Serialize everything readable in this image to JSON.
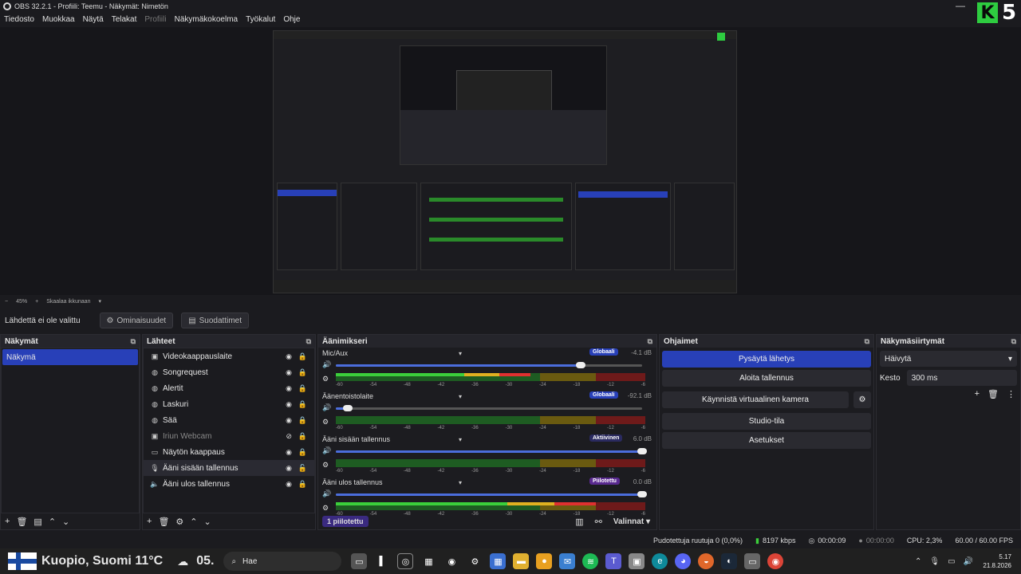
{
  "window": {
    "title": "OBS 32.2.1 - Profiili: Teemu - Näkymät: Nimetön"
  },
  "menu": [
    "Tiedosto",
    "Muokkaa",
    "Näytä",
    "Telakat",
    "Profiili",
    "Näkymäkokoelma",
    "Työkalut",
    "Ohje"
  ],
  "brand": {
    "k": "K",
    "num": "5"
  },
  "zoom": {
    "level": "45%",
    "mode": "Skaalaa ikkunaan"
  },
  "context": {
    "no_source": "Lähdettä ei ole valittu",
    "properties": "Ominaisuudet",
    "filters": "Suodattimet"
  },
  "scenes": {
    "title": "Näkymät",
    "items": [
      "Näkymä"
    ]
  },
  "sources": {
    "title": "Lähteet",
    "items": [
      {
        "label": "Videokaappauslaite",
        "icon": "camera-icon"
      },
      {
        "label": "Songrequest",
        "icon": "globe-icon"
      },
      {
        "label": "Alertit",
        "icon": "globe-icon"
      },
      {
        "label": "Laskuri",
        "icon": "globe-icon"
      },
      {
        "label": "Sää",
        "icon": "globe-icon"
      },
      {
        "label": "Iriun Webcam",
        "icon": "camera-icon"
      },
      {
        "label": "Näytön kaappaus",
        "icon": "monitor-icon"
      },
      {
        "label": "Ääni sisään tallennus",
        "icon": "mic-icon"
      },
      {
        "label": "Ääni ulos tallennus",
        "icon": "speaker-icon"
      }
    ]
  },
  "mixer": {
    "title": "Äänimikseri",
    "channels": [
      {
        "name": "Mic/Aux",
        "badge": "Globaali",
        "db": "-4.1 dB",
        "color": "#2840b8",
        "vol": 0.8,
        "lvl": 0.63
      },
      {
        "name": "Äänentoistolaite",
        "badge": "Globaali",
        "db": "-92.1 dB",
        "color": "#2840b8",
        "vol": 0.04,
        "lvl": 0.0
      },
      {
        "name": "Ääni sisään tallennus",
        "badge": "Aktiivinen",
        "db": "6.0 dB",
        "color": "#2a2a60",
        "vol": 1.0,
        "lvl": 0.0
      },
      {
        "name": "Ääni ulos tallennus",
        "badge": "Piilotettu",
        "db": "0.0 dB",
        "color": "#5a2a90",
        "vol": 1.0,
        "lvl": 0.84
      }
    ],
    "ticks": [
      "-60",
      "-54",
      "-48",
      "-42",
      "-36",
      "-30",
      "-24",
      "-18",
      "-12",
      "-6"
    ],
    "hidden_btn": "1 piilotettu",
    "options": "Valinnat"
  },
  "controls": {
    "title": "Ohjaimet",
    "stop_stream": "Pysäytä lähetys",
    "start_rec": "Aloita tallennus",
    "virtual_cam": "Käynnistä virtuaalinen kamera",
    "studio": "Studio-tila",
    "settings": "Asetukset"
  },
  "transitions": {
    "title": "Näkymäsiirtymät",
    "selected": "Häivytä",
    "duration_label": "Kesto",
    "duration": "300 ms"
  },
  "status": {
    "dropped": "Pudotettuja ruutuja 0 (0,0%)",
    "kbps": "8197 kbps",
    "stream_time": "00:00:09",
    "rec_time": "00:00:00",
    "cpu": "CPU: 2,3%",
    "fps": "60.00 / 60.00 FPS"
  },
  "taskbar": {
    "weather": "Kuopio, Suomi 11°C",
    "num": "05.",
    "search": "Hae",
    "time": "5.17",
    "date": "21.8.2026"
  }
}
